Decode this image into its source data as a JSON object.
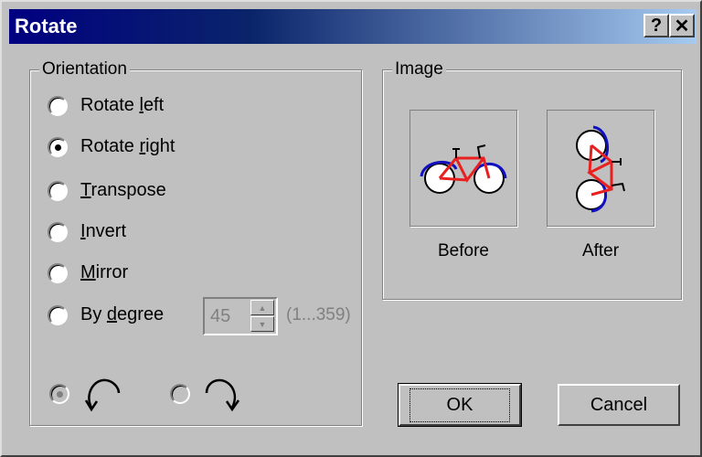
{
  "window": {
    "title": "Rotate",
    "help_glyph": "?",
    "close_glyph": "✕"
  },
  "orientation": {
    "label": "Orientation",
    "options": [
      {
        "label": "Rotate left",
        "checked": false
      },
      {
        "label": "Rotate right",
        "checked": true
      },
      {
        "label": "Transpose",
        "checked": false
      },
      {
        "label": "Invert",
        "checked": false
      },
      {
        "label": "Mirror",
        "checked": false
      },
      {
        "label": "By degree",
        "checked": false
      }
    ],
    "degree": {
      "value": "45",
      "range": "(1...359)"
    },
    "direction": {
      "ccw_checked": true,
      "cw_checked": false
    }
  },
  "image": {
    "label": "Image",
    "before": "Before",
    "after": "After"
  },
  "buttons": {
    "ok": "OK",
    "cancel": "Cancel"
  },
  "colors": {
    "frame": "#e82020",
    "tire_shadow": "#1010c0"
  }
}
